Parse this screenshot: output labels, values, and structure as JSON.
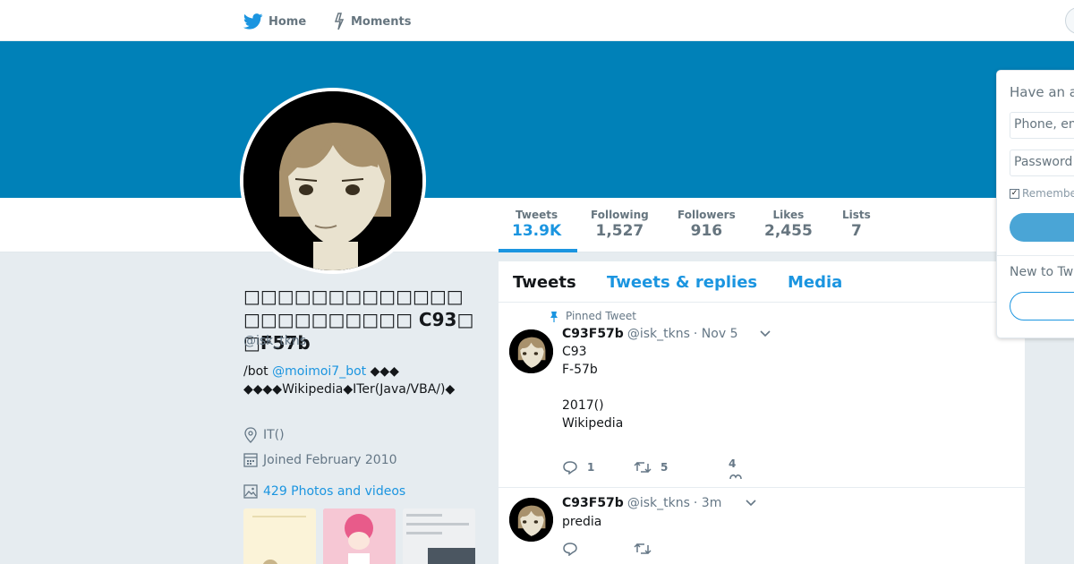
{
  "nav": {
    "home_label": "Home",
    "moments_label": "Moments"
  },
  "profile": {
    "name": "□□□□□□□□□□□□□□□□□□□□□□□ C93□□F57b",
    "handle": "@isk_tkns",
    "bio_prefix": "/bot",
    "bio_mention": "@moimoi7_bot",
    "bio_mid": " ◆◆◆",
    "bio_rest": "◆◆◆◆Wikipedia◆ITer(Java/VBA/)◆",
    "location": "IT()",
    "joined": "Joined February 2010",
    "photos_link": "429 Photos and videos"
  },
  "stats": {
    "tweets": {
      "label": "Tweets",
      "value": "13.9K"
    },
    "following": {
      "label": "Following",
      "value": "1,527"
    },
    "followers": {
      "label": "Followers",
      "value": "916"
    },
    "likes": {
      "label": "Likes",
      "value": "2,455"
    },
    "lists": {
      "label": "Lists",
      "value": "7"
    }
  },
  "timeline": {
    "tabs": [
      "Tweets",
      "Tweets & replies",
      "Media"
    ],
    "tweets": [
      {
        "pinned_label": "Pinned Tweet",
        "name": "C93F57b",
        "handle": "@isk_tkns",
        "time": "· Nov 5",
        "lines": [
          "C93",
          "F-57b",
          "",
          "2017()",
          "Wikipedia"
        ],
        "replies": "1",
        "retweets": "5",
        "likes": "4"
      },
      {
        "name": "C93F57b",
        "handle": "@isk_tkns",
        "time": "· 3m",
        "lines": [
          "predia"
        ]
      }
    ]
  },
  "login": {
    "title": "Have an account?",
    "phone_placeholder": "Phone, email or username",
    "password_placeholder": "Password",
    "remember_label": "Remember me",
    "new_label": "New to Twitter?"
  },
  "colors": {
    "banner": "#0081b8",
    "accent": "#1b95e0",
    "background": "#e6ecf0"
  }
}
